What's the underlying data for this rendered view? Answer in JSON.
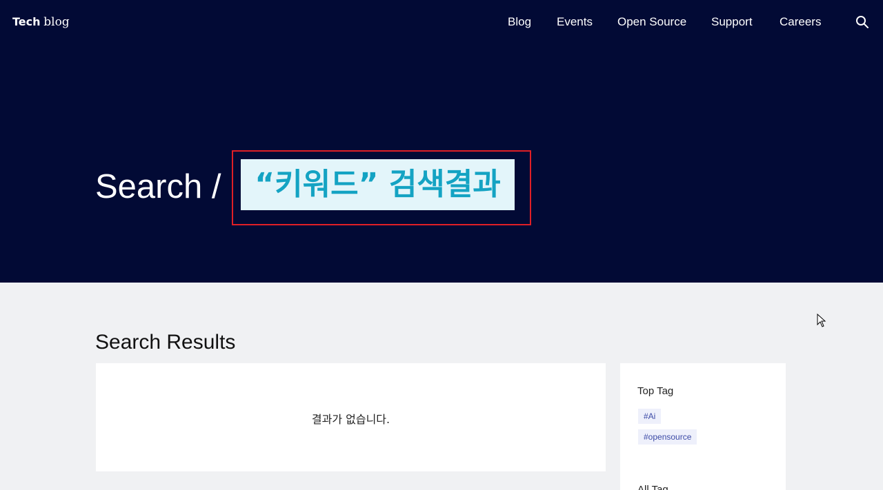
{
  "header": {
    "logo_bold": "Tech",
    "logo_light": "blog",
    "nav": [
      "Blog",
      "Events",
      "Open Source",
      "Support",
      "Careers"
    ],
    "search_icon": "search-icon"
  },
  "hero": {
    "prefix": "Search /",
    "keyword": "“키워드” 검색결과"
  },
  "main": {
    "section_title": "Search Results",
    "empty_message": "결과가 없습니다."
  },
  "sidebar": {
    "top_tag_title": "Top Tag",
    "tags": [
      "#Ai",
      "#opensource"
    ],
    "all_tag_title": "All Tag"
  },
  "colors": {
    "hero_bg": "#020a35",
    "keyword": "#14a3c3",
    "highlight_border": "#e01f26"
  }
}
